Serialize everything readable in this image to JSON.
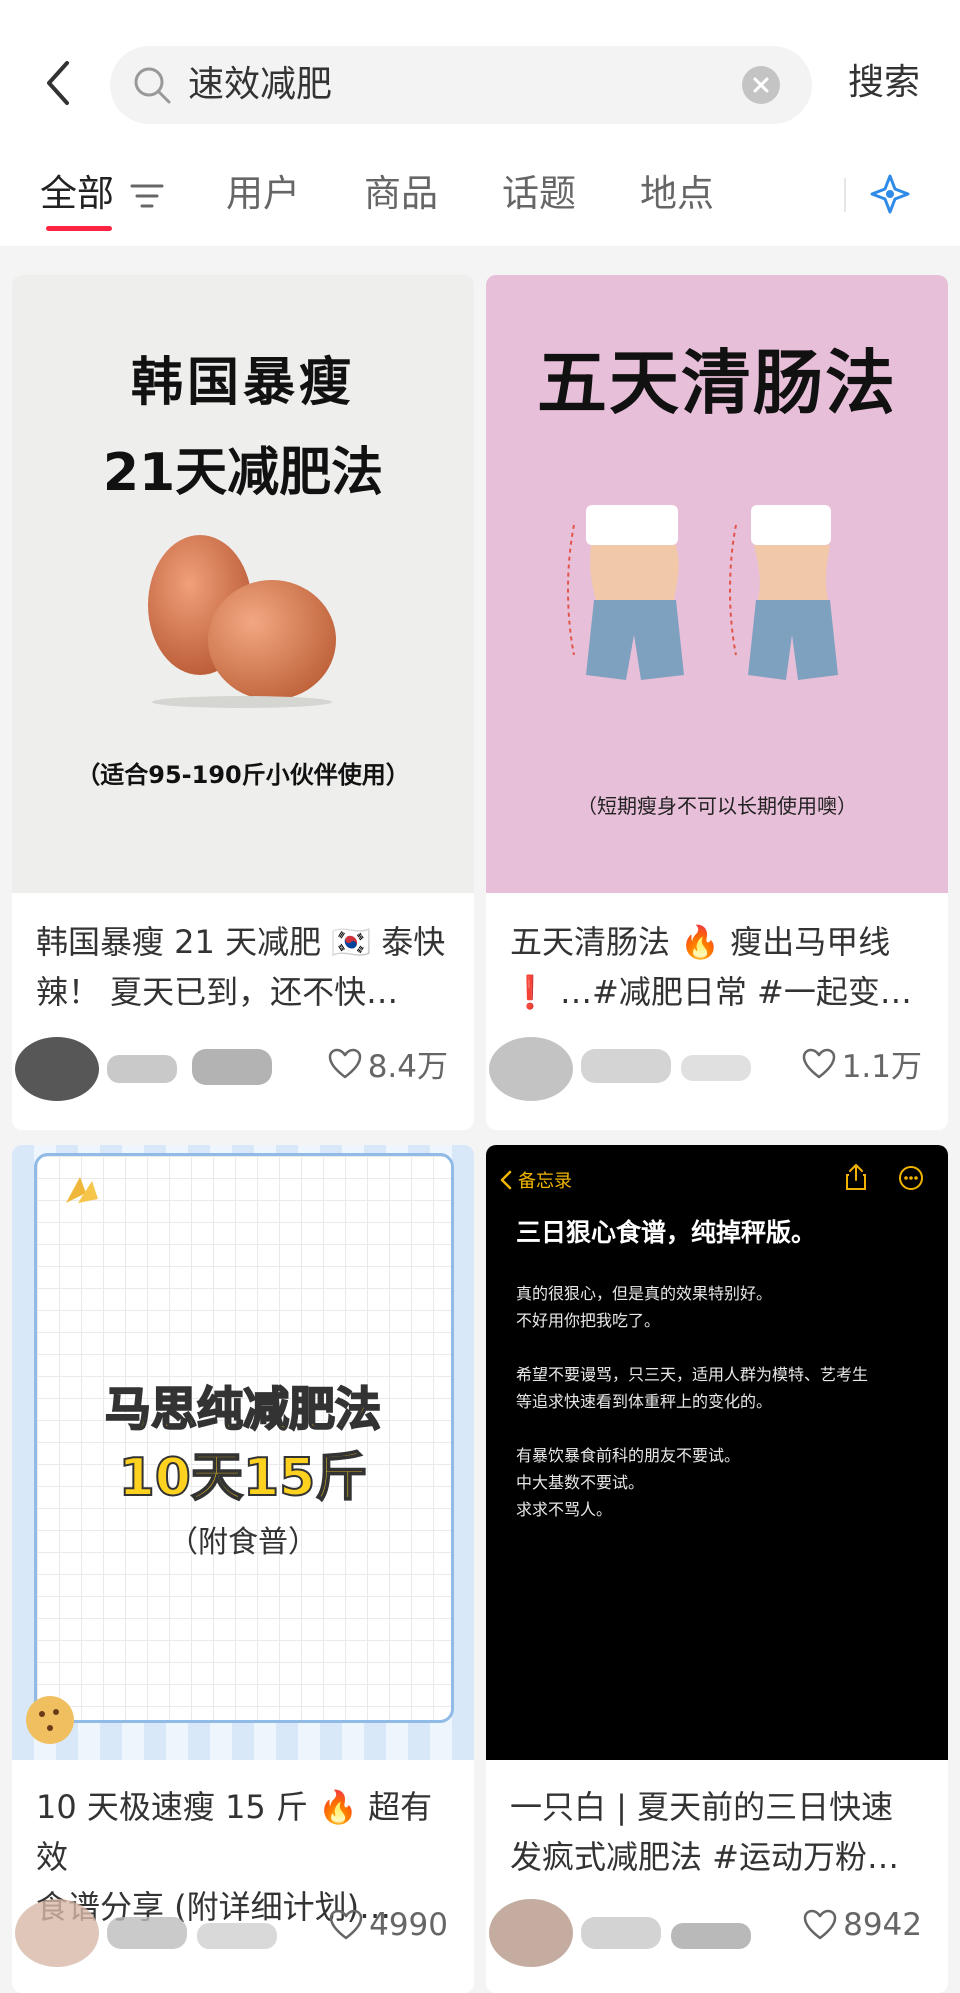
{
  "search": {
    "query": "速效减肥",
    "button_label": "搜索"
  },
  "tabs": [
    {
      "label": "全部"
    },
    {
      "label": "用户"
    },
    {
      "label": "商品"
    },
    {
      "label": "话题"
    },
    {
      "label": "地点"
    }
  ],
  "cards": [
    {
      "cover": {
        "title1": "韩国暴瘦",
        "title2": "21天减肥法",
        "footnote": "（适合95-190斤小伙伴使用）"
      },
      "title_line1": "韩国暴瘦 21 天减肥 🇰🇷 泰快",
      "title_line2": "辣！ 夏天已到，还不快…",
      "likes": "8.4万"
    },
    {
      "cover": {
        "title": "五天清肠法",
        "footnote": "（短期瘦身不可以长期使用噢）"
      },
      "title_line1": "五天清肠法 🔥 瘦出马甲线",
      "title_line2": "❗ …#减肥日常 #一起变…",
      "likes": "1.1万"
    },
    {
      "cover": {
        "title1": "马思纯减肥法",
        "title2": "10天15斤",
        "subtitle": "（附食普）"
      },
      "title_line1": "10 天极速瘦 15 斤 🔥 超有效",
      "title_line2": "食谱分享 (附详细计划)…",
      "likes": "4990"
    },
    {
      "cover": {
        "back_label": "备忘录",
        "heading": "三日狠心食谱，纯掉秤版。",
        "lines": [
          "真的很狠心，但是真的效果特别好。",
          "不好用你把我吃了。",
          "",
          "希望不要谩骂，只三天，适用人群为模特、艺考生",
          "等追求快速看到体重秤上的变化的。",
          "",
          "有暴饮暴食前科的朋友不要试。",
          "中大基数不要试。",
          "求求不骂人。"
        ]
      },
      "title_line1": "一只白 | 夏天前的三日快速",
      "title_line2": "发疯式减肥法 #运动万粉…",
      "likes": "8942"
    }
  ],
  "colors": {
    "accent": "#ff2442",
    "pink_cover": "#e8bfd9",
    "memo_bg": "#000000",
    "memo_accent": "#f0b400"
  }
}
